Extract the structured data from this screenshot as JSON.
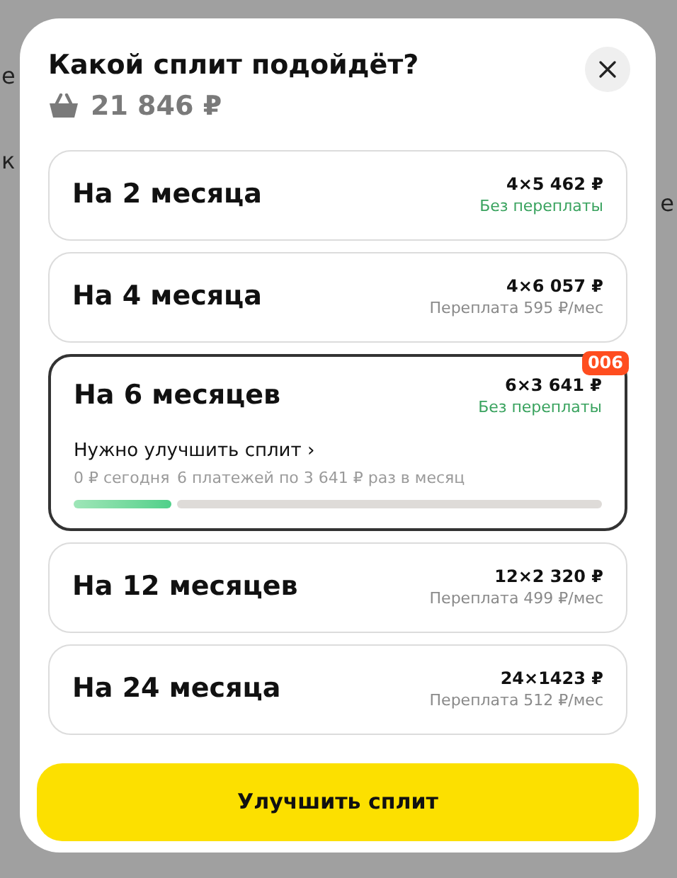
{
  "background_left": [
    "е",
    "к"
  ],
  "background_right": [
    "е"
  ],
  "dialog": {
    "title": "Какой сплит подойдёт?",
    "total": "21 846 ₽",
    "options": [
      {
        "title": "На 2 месяца",
        "amount": "4×5 462 ₽",
        "note": "Без переплаты",
        "no_overpay": true,
        "selected": false
      },
      {
        "title": "На 4 месяца",
        "amount": "4×6 057 ₽",
        "note": "Переплата 595 ₽/мес",
        "no_overpay": false,
        "selected": false
      },
      {
        "title": "На 6 месяцев",
        "amount": "6×3 641 ₽",
        "note": "Без переплаты",
        "no_overpay": true,
        "selected": true,
        "badge": "006",
        "hint": "Нужно улучшить сплит",
        "hint_arrow": "›",
        "schedule": [
          {
            "label": "0 ₽ сегодня",
            "paid": true
          },
          {
            "label": "6 платежей по 3 641 ₽ раз в месяц",
            "paid": false
          }
        ]
      },
      {
        "title": "На 12 месяцев",
        "amount": "12×2 320 ₽",
        "note": "Переплата 499 ₽/мес",
        "no_overpay": false,
        "selected": false
      },
      {
        "title": "На 24 месяца",
        "amount": "24×1423 ₽",
        "note": "Переплата 512 ₽/мес",
        "no_overpay": false,
        "selected": false
      }
    ],
    "button": "Улучшить сплит"
  }
}
